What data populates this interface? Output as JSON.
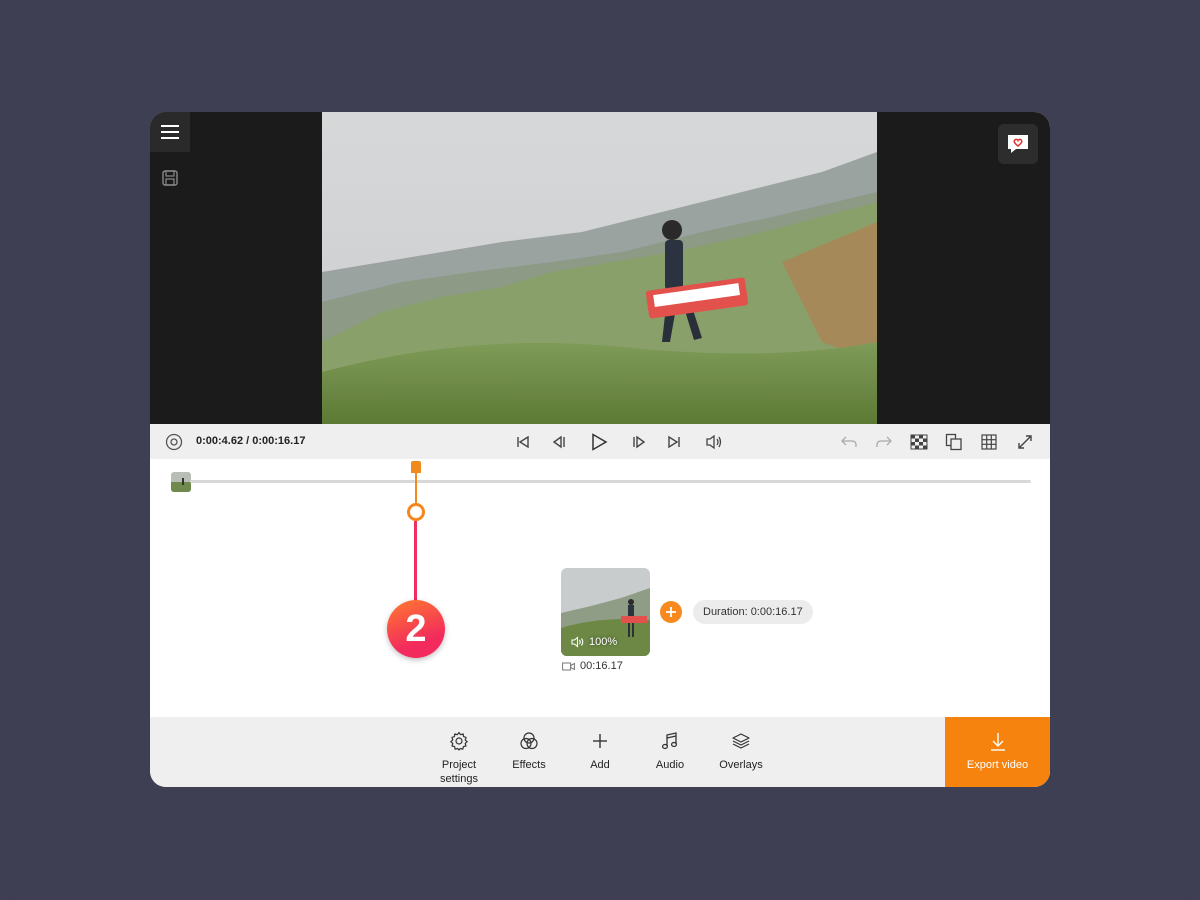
{
  "player": {
    "timecode": "0:00:4.62 / 0:00:16.17"
  },
  "timeline": {
    "clip_volume": "100%",
    "clip_length": "00:16.17",
    "duration_label": "Duration: 0:00:16.17",
    "callout_number": "2"
  },
  "toolbar": {
    "items": [
      {
        "label": "Project settings",
        "icon": "gear-icon"
      },
      {
        "label": "Effects",
        "icon": "effects-icon"
      },
      {
        "label": "Add",
        "icon": "plus-icon"
      },
      {
        "label": "Audio",
        "icon": "music-note-icon"
      },
      {
        "label": "Overlays",
        "icon": "layers-icon"
      }
    ],
    "export_label": "Export video"
  },
  "colors": {
    "accent": "#f7830f",
    "callout": "#f22a5d",
    "backdrop": "#3f3f54"
  }
}
